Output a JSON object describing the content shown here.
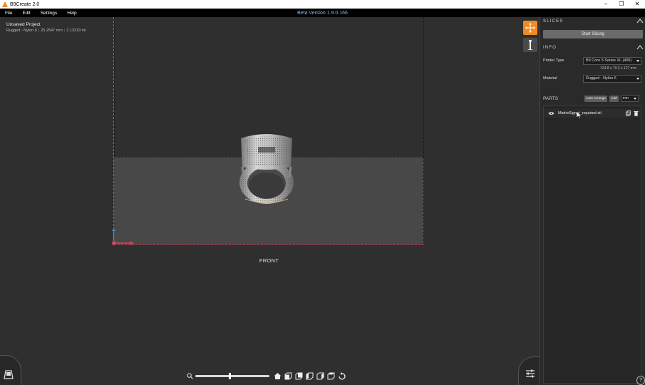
{
  "window": {
    "title": "B9Create 2.0",
    "buttons": [
      "–",
      "❐",
      "✕"
    ]
  },
  "menu": {
    "items": [
      "File",
      "Edit",
      "Settings",
      "Help"
    ],
    "version": "Beta Version 1.9.0.166"
  },
  "project": {
    "title": "Unsaved Project",
    "material": "Rugged - Nylon 6",
    "size": "25.2547 mm",
    "volume": "2.13219 ml"
  },
  "viewport": {
    "front_label": "FRONT",
    "zoom_level": 0.47,
    "colors": {
      "accent": "#f08a24",
      "x_axis": "#d8425a",
      "y_axis": "#4d80c8"
    }
  },
  "panel": {
    "slices_header": "SLICES",
    "start_slicing": "Start Slicing",
    "info_header": "INFO",
    "printer_type_label": "Printer Type",
    "printer_type": "B9 Core 5 Series XL (405)",
    "build_dims": "124.8 x 70.2 x 127 mm",
    "material_label": "Material",
    "material": "Rugged - Nylon 6",
    "parts_label": "PARTS",
    "auto_arrange": "Auto Arrange",
    "add": "Add",
    "unit": "mm",
    "parts": [
      {
        "name": "MatrixSignet_repaired.stl"
      }
    ]
  },
  "help": "?"
}
